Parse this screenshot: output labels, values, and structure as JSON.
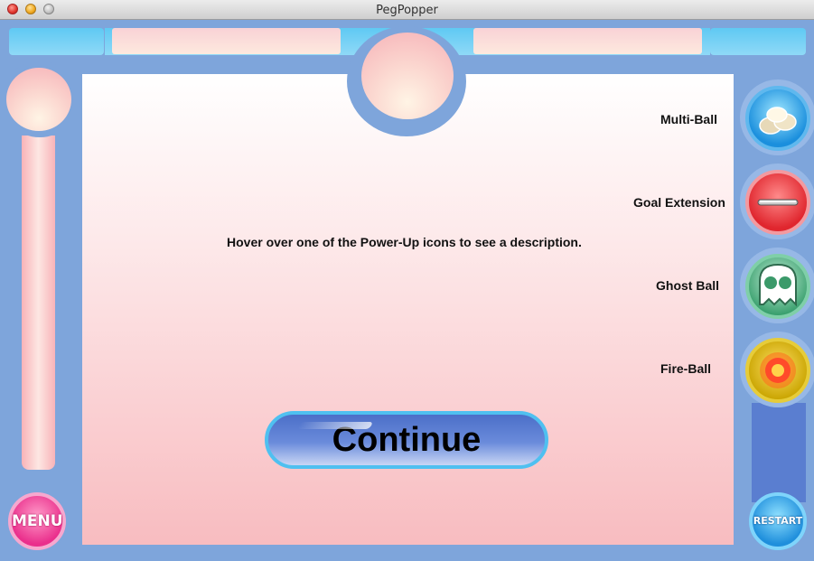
{
  "window": {
    "title": "PegPopper"
  },
  "powerups": [
    {
      "label": "Multi-Ball",
      "icon": "multi-ball-icon"
    },
    {
      "label": "Goal Extension",
      "icon": "goal-extension-icon"
    },
    {
      "label": "Ghost Ball",
      "icon": "ghost-ball-icon"
    },
    {
      "label": "Fire-Ball",
      "icon": "fire-ball-icon"
    }
  ],
  "description": "Hover over one of the Power-Up icons to see a description.",
  "buttons": {
    "continue": "Continue",
    "menu": "MENU",
    "restart": "RESTART"
  },
  "colors": {
    "frame": "#7ea5db",
    "accent_cyan": "#5fc9f3",
    "pink": "#f8bcc0",
    "menu": "#ea2f8c",
    "restart": "#1f8fdc",
    "continue": "#4b6fc8"
  }
}
